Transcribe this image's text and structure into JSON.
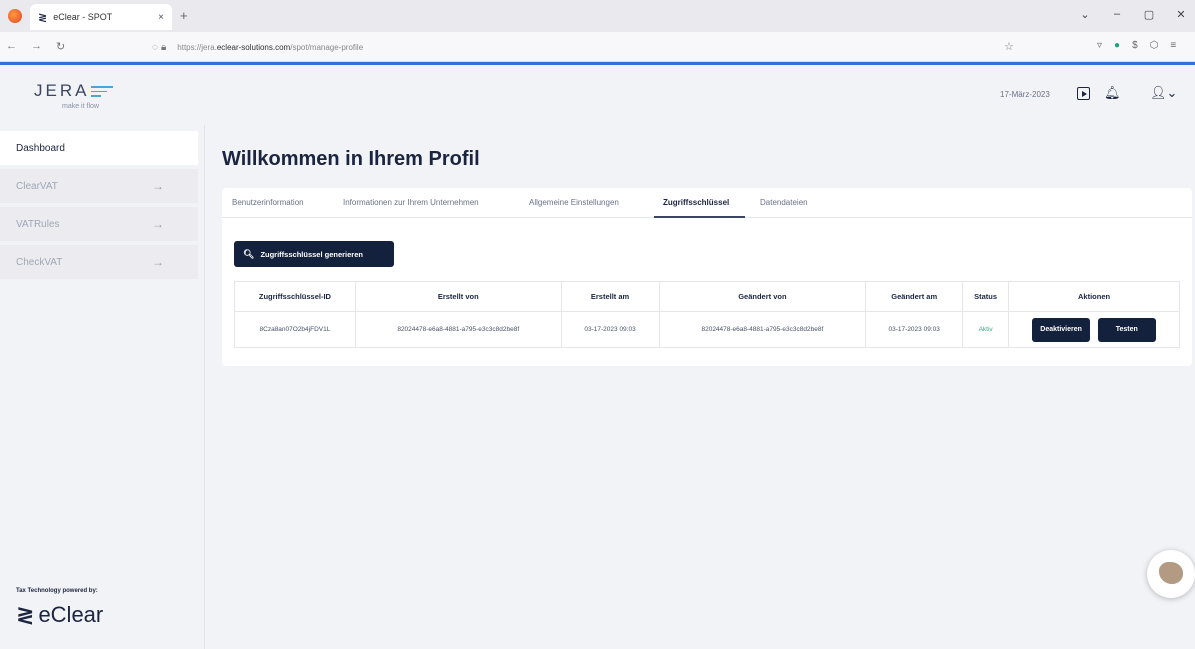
{
  "browser": {
    "tab_title": "eClear - SPOT",
    "tab_close": "×",
    "new_tab": "+",
    "url_prefix": "https://jera.",
    "url_host": "eclear-solutions.com",
    "url_path": "/spot/manage-profile",
    "window_controls": [
      "⌄",
      "–",
      "▢",
      "✕"
    ]
  },
  "header": {
    "brand": "JERA",
    "tagline": "make it flow",
    "date": "17-März-2023"
  },
  "sidebar": {
    "items": [
      {
        "label": "Dashboard",
        "arrow": ""
      },
      {
        "label": "ClearVAT",
        "arrow": "→"
      },
      {
        "label": "VATRules",
        "arrow": "→"
      },
      {
        "label": "CheckVAT",
        "arrow": "→"
      }
    ],
    "powered_by": "Tax Technology powered by:",
    "eclear_logo": "eClear"
  },
  "main": {
    "title": "Willkommen in Ihrem Profil",
    "tabs": [
      {
        "label": "Benutzerinformation"
      },
      {
        "label": "Informationen zur Ihrem Unternehmen"
      },
      {
        "label": "Allgemeine Einstellungen"
      },
      {
        "label": "Zugriffsschlüssel"
      },
      {
        "label": "Datendateien"
      }
    ],
    "active_tab": "Zugriffsschlüssel",
    "generate_button": "Zugriffsschlüssel generieren",
    "table": {
      "headers": [
        "Zugriffsschlüssel-ID",
        "Erstellt von",
        "Erstellt am",
        "Geändert von",
        "Geändert am",
        "Status",
        "Aktionen"
      ],
      "rows": [
        {
          "id": "8Cza8an07O2b4jFDV1L",
          "created_by": "82024478-e6a8-4881-a795-e3c3c8d2be8f",
          "created_at": "03-17-2023 09:03",
          "modified_by": "82024478-e6a8-4881-a795-e3c3c8d2be8f",
          "modified_at": "03-17-2023 09:03",
          "status": "Aktiv",
          "deactivate": "Deaktivieren",
          "test": "Testen"
        }
      ]
    }
  }
}
